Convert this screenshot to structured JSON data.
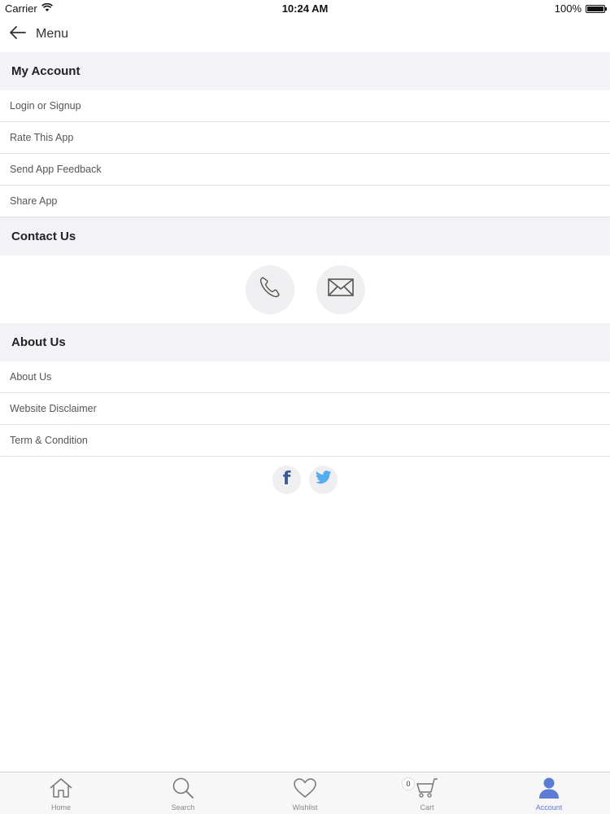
{
  "status_bar": {
    "carrier": "Carrier",
    "time": "10:24 AM",
    "battery": "100%",
    "battery_level": 1.0
  },
  "nav": {
    "title": "Menu",
    "back_icon": "arrow-left-icon"
  },
  "my_account": {
    "title": "My Account",
    "items": [
      "Login or Signup",
      "Rate This App",
      "Send App Feedback",
      "Share App"
    ]
  },
  "contact": {
    "title": "Contact Us",
    "icons": [
      "phone-icon",
      "mail-icon"
    ]
  },
  "about": {
    "title": "About Us",
    "items": [
      "About Us",
      "Website Disclaimer",
      "Term & Condition"
    ]
  },
  "social": {
    "facebook_glyph": "f",
    "icons": [
      "facebook-icon",
      "twitter-icon"
    ],
    "facebook_color": "#3b5998",
    "twitter_color": "#55acee"
  },
  "tab_bar": {
    "tabs": [
      {
        "label": "Home",
        "icon": "home-icon"
      },
      {
        "label": "Search",
        "icon": "search-icon"
      },
      {
        "label": "Wishlist",
        "icon": "heart-icon"
      },
      {
        "label": "Cart",
        "icon": "cart-icon"
      },
      {
        "label": "Account",
        "icon": "user-icon"
      }
    ],
    "cart_count": "0",
    "active_tab": "Account",
    "active_color": "#5b7bd5"
  }
}
